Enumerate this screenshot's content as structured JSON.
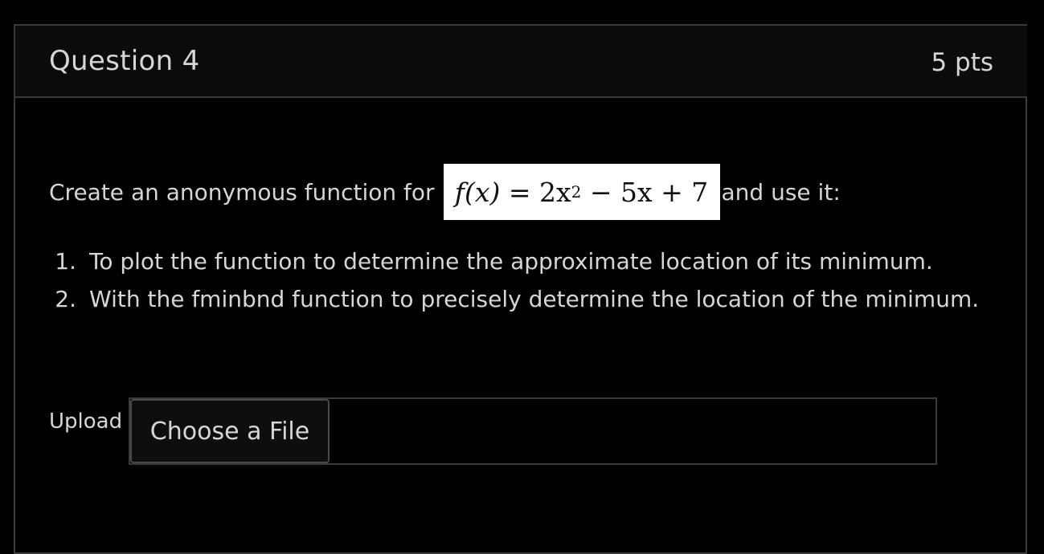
{
  "question": {
    "title": "Question 4",
    "points": "5 pts"
  },
  "prompt": {
    "before": "Create an anonymous function for",
    "formula": {
      "lhs": "f(x)",
      "equals": "=",
      "coefficient": "2x",
      "exponent": "2",
      "rest": "− 5x + 7"
    },
    "after": "and use it:"
  },
  "steps": [
    {
      "number": "1.",
      "text": "To plot the function to determine the approximate location of its minimum."
    },
    {
      "number": "2.",
      "text": "With the fminbnd function to precisely determine the location of the minimum."
    }
  ],
  "upload": {
    "label": "Upload",
    "button_label": "Choose a File"
  },
  "colors": {
    "background": "#000000",
    "text": "#d6d6d6",
    "border": "#3a3a3a",
    "formula_background": "#ffffff"
  }
}
